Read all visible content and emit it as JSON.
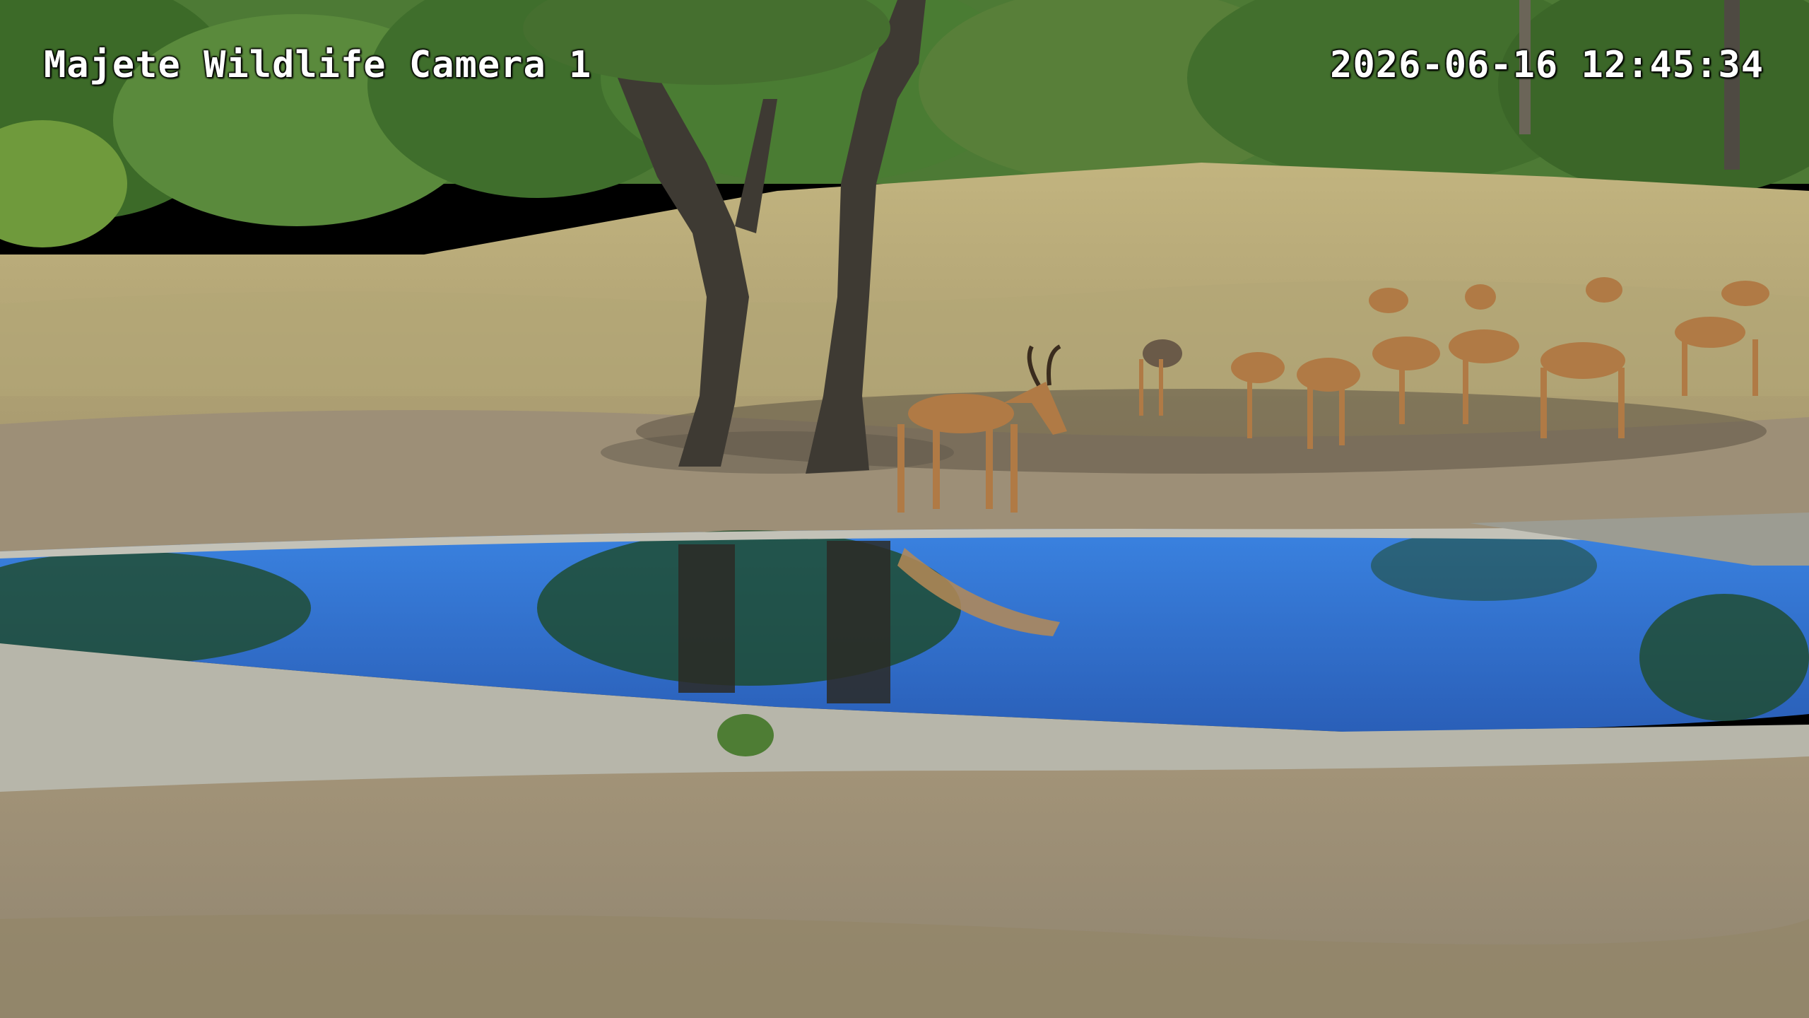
{
  "overlay": {
    "camera_name": "Majete Wildlife Camera 1",
    "timestamp": "2026-06-16 12:45:34"
  },
  "colors": {
    "sky": "#c9dcea",
    "foliage": "#3f6a2e",
    "dry_grass": "#b9ad7c",
    "bare_soil": "#9d8f77",
    "water": "#2f74d8",
    "rock_edge": "#a8a89e",
    "impala_coat": "#b07a45",
    "overlay_text": "#ffffff"
  }
}
